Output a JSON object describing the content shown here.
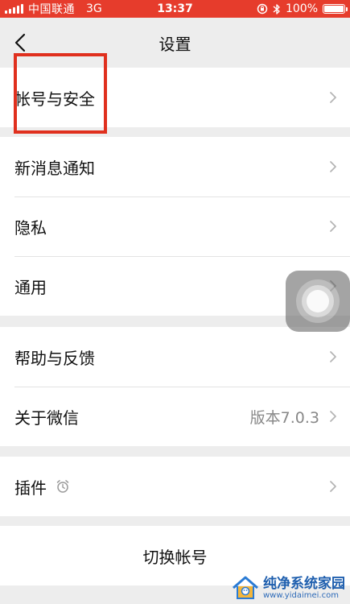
{
  "status_bar": {
    "carrier": "中国联通",
    "network": "3G",
    "time": "13:37",
    "battery": "100%",
    "battery_level": 1.0,
    "bg_color": "#e63c2c"
  },
  "nav": {
    "title": "设置",
    "back_icon": "chevron-left-icon"
  },
  "groups": [
    {
      "items": [
        {
          "label": "帐号与安全"
        }
      ]
    },
    {
      "items": [
        {
          "label": "新消息通知"
        },
        {
          "label": "隐私"
        },
        {
          "label": "通用"
        }
      ]
    },
    {
      "items": [
        {
          "label": "帮助与反馈"
        },
        {
          "label": "关于微信",
          "value": "版本7.0.3"
        }
      ]
    },
    {
      "items": [
        {
          "label": "插件",
          "icon": "plugin-alarm-icon"
        }
      ]
    }
  ],
  "switch_account": {
    "label": "切换帐号"
  },
  "annotation": {
    "highlight_color": "#e0301e"
  },
  "watermark": {
    "title": "纯净系统家园",
    "url": "www.yidaimei.com"
  }
}
